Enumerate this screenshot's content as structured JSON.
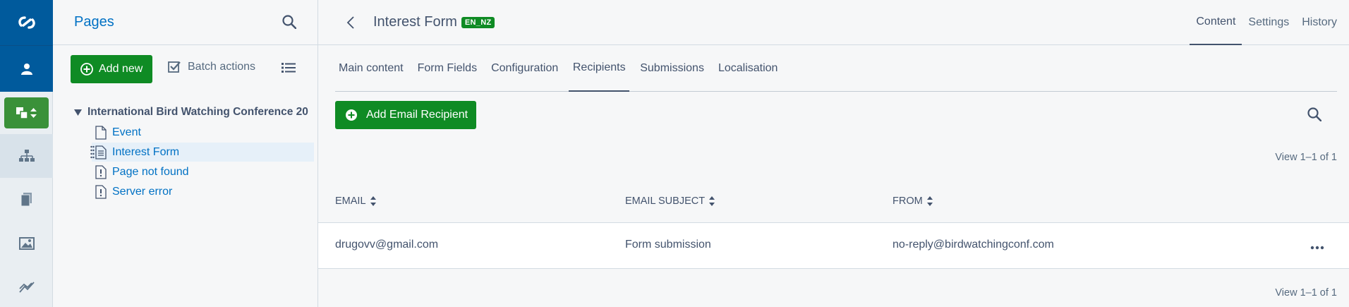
{
  "tree_panel": {
    "title": "Pages",
    "add_new_label": "Add new",
    "batch_actions_label": "Batch actions",
    "root_label": "International Bird Watching Conference 20",
    "nodes": [
      {
        "label": "Event",
        "icon": "page-icon"
      },
      {
        "label": "Interest Form",
        "icon": "form-page-icon",
        "selected": true
      },
      {
        "label": "Page not found",
        "icon": "error-page-icon"
      },
      {
        "label": "Server error",
        "icon": "error-page-icon"
      }
    ]
  },
  "header": {
    "title": "Interest Form",
    "locale": "EN_NZ",
    "tabs": [
      {
        "label": "Content",
        "active": true
      },
      {
        "label": "Settings"
      },
      {
        "label": "History"
      }
    ]
  },
  "sub_tabs": [
    {
      "label": "Main content"
    },
    {
      "label": "Form Fields"
    },
    {
      "label": "Configuration"
    },
    {
      "label": "Recipients",
      "active": true
    },
    {
      "label": "Submissions"
    },
    {
      "label": "Localisation"
    }
  ],
  "recipients": {
    "add_label": "Add Email Recipient",
    "view_count_top": "View 1–1 of 1",
    "view_count_bottom": "View 1–1 of 1",
    "columns": [
      "EMAIL",
      "EMAIL SUBJECT",
      "FROM"
    ],
    "rows": [
      {
        "email": "drugovv@gmail.com",
        "subject": "Form submission",
        "from": "no-reply@birdwatchingconf.com"
      }
    ]
  },
  "colors": {
    "brand_blue": "#005a9c",
    "primary_green": "#0f8b24",
    "link_blue": "#0071c4"
  }
}
